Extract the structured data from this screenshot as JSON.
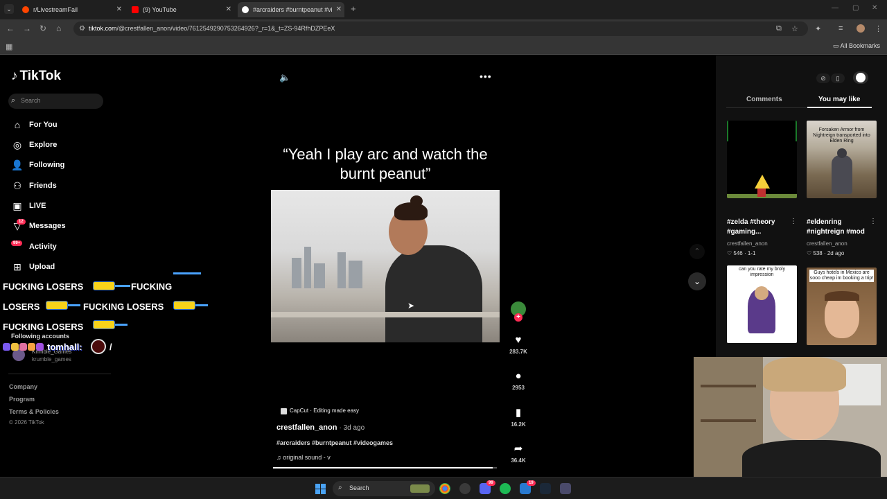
{
  "browser": {
    "tabs": [
      {
        "label": "r/LivestreamFail",
        "active": false,
        "icon_color": "#ff4500"
      },
      {
        "label": "(9) YouTube",
        "active": false,
        "icon_color": "#ff0000"
      },
      {
        "label": "#arcraiders #burntpeanut #vide",
        "active": true,
        "icon_color": "#ffffff"
      }
    ],
    "url_host": "tiktok.com",
    "url_path": "/@crestfallen_anon/video/7612549290753264926?_r=1&_t=ZS-94RfhDZPEeX",
    "all_bookmarks": "All Bookmarks"
  },
  "sidebar": {
    "logo": "TikTok",
    "search_placeholder": "Search",
    "nav": [
      {
        "label": "For You",
        "icon": "home-icon"
      },
      {
        "label": "Explore",
        "icon": "compass-icon"
      },
      {
        "label": "Following",
        "icon": "following-icon"
      },
      {
        "label": "Friends",
        "icon": "friends-icon"
      },
      {
        "label": "LIVE",
        "icon": "live-icon"
      },
      {
        "label": "Messages",
        "icon": "messages-icon",
        "badge": "12"
      },
      {
        "label": "Activity",
        "icon": "activity-icon",
        "badge": "99+"
      },
      {
        "label": "Upload",
        "icon": "upload-icon"
      }
    ],
    "following_header": "Following accounts",
    "following_account": {
      "name": "Krimble_Games",
      "handle": "krumble_games"
    },
    "footer_links": [
      "Company",
      "Program",
      "Terms & Policies"
    ],
    "copyright": "© 2026 TikTok"
  },
  "stream_overlay": {
    "alert_lines": [
      "FUCKING LOSERS",
      "FUCKING",
      "LOSERS",
      "FUCKING LOSERS",
      "FUCKING LOSERS"
    ],
    "chat_name": "tomhall:",
    "chat_tail": "/"
  },
  "video": {
    "caption": "“Yeah I play arc and watch the burnt peanut”",
    "capcut": "CapCut · Editing made easy",
    "author": "crestfallen_anon",
    "posted": "· 3d ago",
    "hashtags": "#arcraiders #burntpeanut #videogames",
    "sound": "original sound - v",
    "progress": 0.98,
    "likes": "283.7K",
    "comments": "2953",
    "saves": "16.2K",
    "shares": "36.4K"
  },
  "right_panel": {
    "tabs": [
      "Comments",
      "You may like"
    ],
    "active_tab": "You may like",
    "thumbnails": [
      {
        "title": "#zelda #theory",
        "title2": "#gaming...",
        "author": "crestfallen_anon",
        "stats": "♡ 546 · 1-1"
      },
      {
        "title": "#eldenring",
        "title2": "#nightreign #mod",
        "author": "crestfallen_anon",
        "stats": "♡ 538 · 2d ago",
        "caption": "Forsaken Armor from Nightreign transported into Elden Ring"
      },
      {
        "caption": "can you rate my broly impression"
      },
      {
        "caption": "Guys hotels in Mexico are sooo cheap im booking a trip!"
      }
    ]
  },
  "taskbar": {
    "search_label": "Search",
    "badges": [
      "99",
      "19"
    ]
  },
  "colors": {
    "tiktok_red": "#fe2c55",
    "background": "#000000",
    "panel": "#111111"
  }
}
